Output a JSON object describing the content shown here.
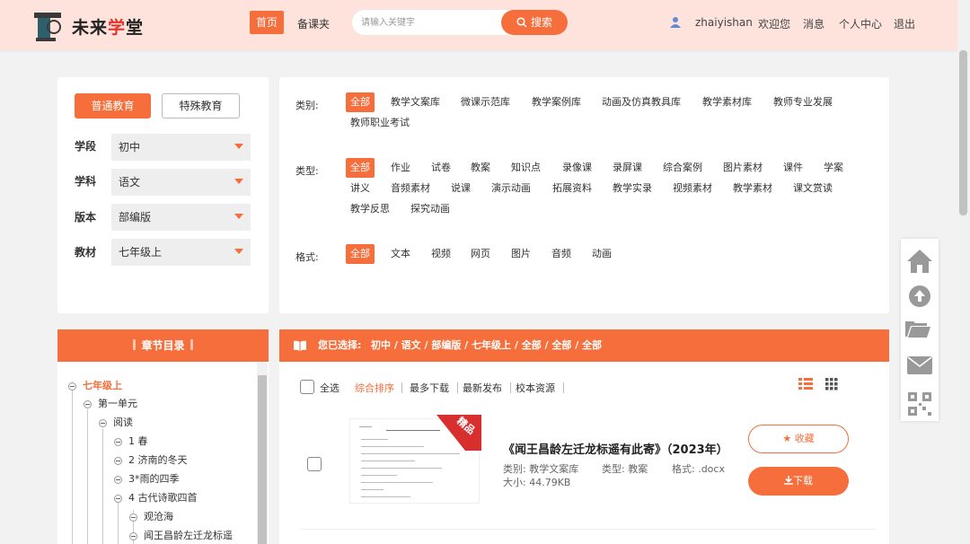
{
  "header": {
    "logo_text_a": "未来",
    "logo_text_b": "学",
    "logo_text_c": "堂",
    "nav_home": "首页",
    "nav_lesson": "备课夹",
    "search_placeholder": "请输入关键字",
    "search_button": "搜索",
    "username": "zhaiyishan",
    "welcome": "欢迎您",
    "messages": "消息",
    "personal_center": "个人中心",
    "logout": "退出"
  },
  "filters": {
    "edu_general": "普通教育",
    "edu_special": "特殊教育",
    "stage_label": "学段",
    "stage_value": "初中",
    "subject_label": "学科",
    "subject_value": "语文",
    "edition_label": "版本",
    "edition_value": "部编版",
    "textbook_label": "教材",
    "textbook_value": "七年级上"
  },
  "categories": {
    "category_label": "类别:",
    "category_items": [
      "全部",
      "教学文案库",
      "微课示范库",
      "教学案例库",
      "动画及仿真教具库",
      "教学素材库",
      "教师专业发展",
      "教师职业考试"
    ],
    "type_label": "类型:",
    "type_items": [
      "全部",
      "作业",
      "试卷",
      "教案",
      "知识点",
      "录像课",
      "录屏课",
      "综合案例",
      "图片素材",
      "课件",
      "学案",
      "讲义",
      "音频素材",
      "说课",
      "演示动画",
      "拓展资料",
      "教学实录",
      "视频素材",
      "教学素材",
      "课文赏读",
      "教学反思",
      "探究动画"
    ],
    "format_label": "格式:",
    "format_items": [
      "全部",
      "文本",
      "视频",
      "网页",
      "图片",
      "音频",
      "动画"
    ]
  },
  "chapter": {
    "title": "章节目录",
    "nodes": [
      "七年级上",
      "第一单元",
      "阅读",
      "1 春",
      "2 济南的冬天",
      "3*雨的四季",
      "4 古代诗歌四首",
      "观沧海",
      "闻王昌龄左迁龙标遥"
    ]
  },
  "selection": {
    "label": "您已选择:",
    "path": "初中 / 语文 / 部编版 / 七年级上 / 全部 / 全部 / 全部"
  },
  "results": {
    "select_all": "全选",
    "sort_composite": "综合排序",
    "sort_downloads": "最多下载",
    "sort_latest": "最新发布",
    "sort_school": "校本资源",
    "items": [
      {
        "badge": "精品",
        "title": "《闻王昌龄左迁龙标遥有此寄》（2023年）",
        "category": "类别: 教学文案库",
        "type": "类型: 教案",
        "format": "格式: .docx",
        "size": "大小: 44.79KB",
        "fav_label": "收藏",
        "download_label": "下载"
      }
    ]
  },
  "colors": {
    "accent": "#f56e3b",
    "header_bg": "#fde3db",
    "page_bg": "#f2f2f2"
  },
  "side_toolbar": [
    "home-icon",
    "upload-icon",
    "folder-icon",
    "mail-icon",
    "qrcode-icon"
  ]
}
